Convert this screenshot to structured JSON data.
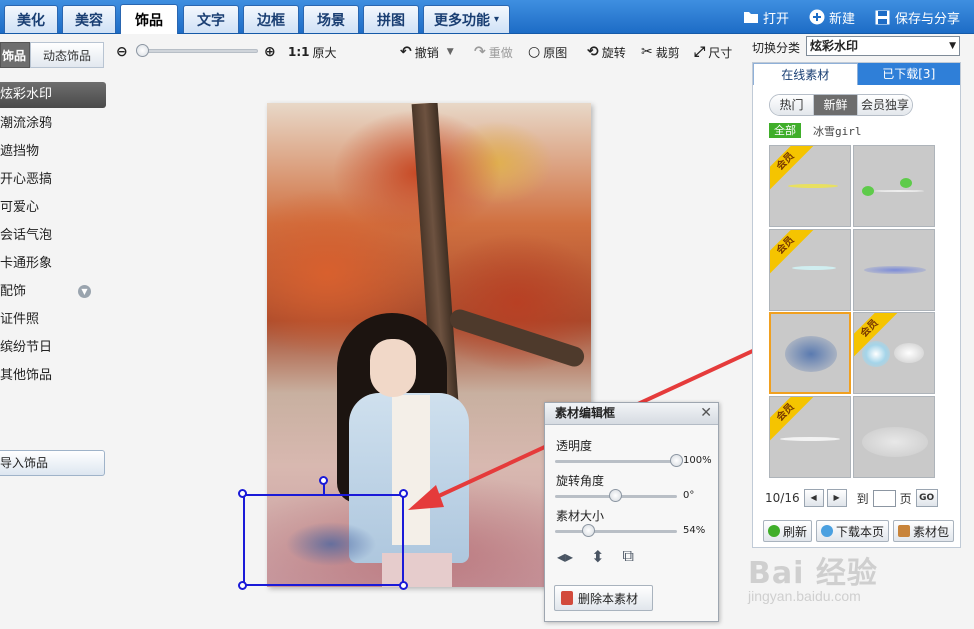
{
  "nav": {
    "tabs": [
      {
        "label": "美化"
      },
      {
        "label": "美容"
      },
      {
        "label": "饰品"
      },
      {
        "label": "文字"
      },
      {
        "label": "边框"
      },
      {
        "label": "场景"
      },
      {
        "label": "拼图"
      },
      {
        "label": "更多功能"
      }
    ],
    "actions": {
      "open": "打开",
      "new": "新建",
      "save_share": "保存与分享"
    }
  },
  "sidebar": {
    "subtabs": {
      "static": "饰品",
      "dynamic": "动态饰品"
    },
    "categories": [
      {
        "label": "炫彩水印"
      },
      {
        "label": "潮流涂鸦"
      },
      {
        "label": "遮挡物"
      },
      {
        "label": "开心恶搞"
      },
      {
        "label": "可爱心"
      },
      {
        "label": "会话气泡"
      },
      {
        "label": "卡通形象"
      },
      {
        "label": "配饰"
      },
      {
        "label": "证件照"
      },
      {
        "label": "缤纷节日"
      },
      {
        "label": "其他饰品"
      }
    ],
    "import_button": "导入饰品"
  },
  "toolbar": {
    "zoom_ratio": "1:1",
    "original_size": "原大",
    "undo": "撤销",
    "redo": "重做",
    "original": "原图",
    "rotate": "旋转",
    "crop": "裁剪",
    "size": "尺寸"
  },
  "editor": {
    "title": "素材编辑框",
    "opacity_label": "透明度",
    "opacity_value": "100%",
    "opacity": 1.0,
    "rotation_label": "旋转角度",
    "rotation_value": "0°",
    "rotation": 0.5,
    "size_label": "素材大小",
    "size_value": "54%",
    "size": 0.28,
    "delete_button": "删除本素材"
  },
  "right_panel": {
    "switch_label": "切换分类",
    "selected_category": "炫彩水印",
    "tabs": {
      "online": "在线素材",
      "downloaded": "已下载[3]"
    },
    "filters": {
      "hot": "热门",
      "fresh": "新鲜",
      "vip_only": "会员独享"
    },
    "tag_all": "全部",
    "tag_author": "冰雪girl",
    "vip_badge": "会员",
    "pager": {
      "current": "10/16",
      "to": "到",
      "page": "页",
      "go": "GO"
    },
    "buttons": {
      "refresh": "刷新",
      "download_page": "下载本页",
      "material_pack": "素材包"
    }
  },
  "watermark": {
    "brand": "Bai 经验",
    "url": "jingyan.baidu.com"
  }
}
